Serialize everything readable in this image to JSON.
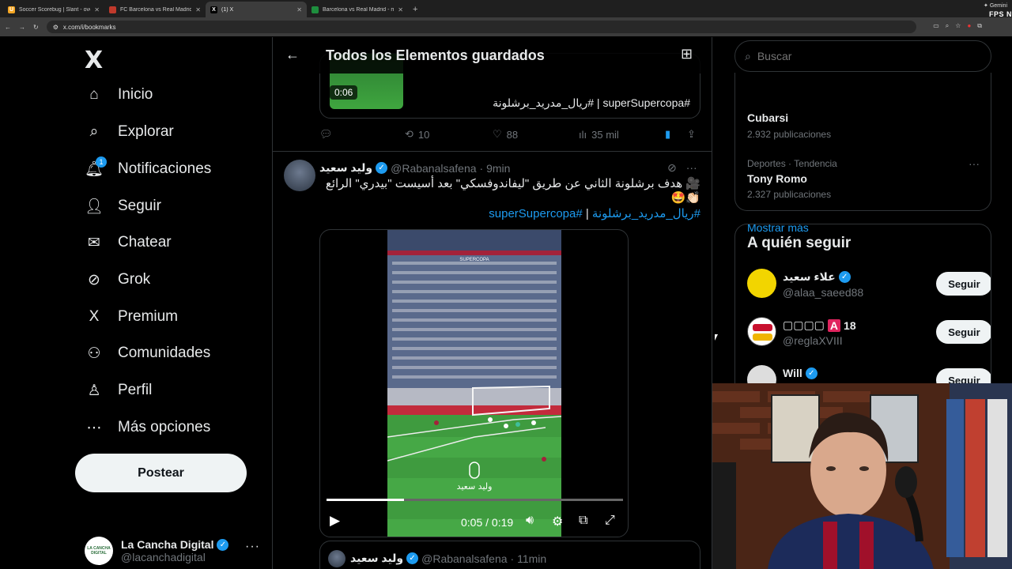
{
  "browser": {
    "tabs": [
      {
        "title": "Soccer Scorebug | Slant - overl",
        "fav_color": "#f5a623",
        "fav_glyph": "U",
        "active": false
      },
      {
        "title": "FC Barcelona vs Real Madrid |",
        "fav_color": "#c0392b",
        "fav_glyph": "",
        "active": false
      },
      {
        "title": "(1) X",
        "fav_color": "#000000",
        "fav_glyph": "X",
        "active": true
      },
      {
        "title": "Barcelona vs Real Madrid - ma",
        "fav_color": "#1e8e3e",
        "fav_glyph": "",
        "active": false
      }
    ],
    "new_tab": "+",
    "gemini": "✦ Gemini",
    "fps": "FPS N",
    "url": "x.com/i/bookmarks"
  },
  "sidebar": {
    "logo": "X",
    "nav": [
      {
        "label": "Inicio",
        "icon": "home-icon",
        "glyph": "⌂"
      },
      {
        "label": "Explorar",
        "icon": "search-icon",
        "glyph": "⌕"
      },
      {
        "label": "Notificaciones",
        "icon": "bell-icon",
        "glyph": "🔔︎",
        "badge": "1"
      },
      {
        "label": "Seguir",
        "icon": "person-add-icon",
        "glyph": "👤︎"
      },
      {
        "label": "Chatear",
        "icon": "mail-icon",
        "glyph": "✉"
      },
      {
        "label": "Grok",
        "icon": "grok-icon",
        "glyph": "⊘"
      },
      {
        "label": "Premium",
        "icon": "x-premium-icon",
        "glyph": "X"
      },
      {
        "label": "Comunidades",
        "icon": "communities-icon",
        "glyph": "⚇"
      },
      {
        "label": "Perfil",
        "icon": "profile-icon",
        "glyph": "♙"
      },
      {
        "label": "Más opciones",
        "icon": "more-circle-icon",
        "glyph": "⋯"
      }
    ],
    "post_label": "Postear",
    "account": {
      "name": "La Cancha Digital",
      "handle": "@lacanchadigital",
      "avatar_text": "LA CANCHA DIGITAL",
      "more": "···"
    }
  },
  "main": {
    "header": {
      "back": "←",
      "title": "Todos los Elementos guardados"
    },
    "tweet1": {
      "duration": "0:06",
      "text": "#superSupercopa | #ريال_مدريد_برشلونة",
      "replies": "",
      "retweets": "10",
      "likes": "88",
      "views": "35 mil"
    },
    "tweet2": {
      "name": "وليد سعيد",
      "handle": "@Rabanalsafena",
      "time": "· 9min",
      "body": "🎥 هدف برشلونة الثاني عن طريق \"ليفاندوفسكي\" بعد أسيست \"بيدري\" الرائع 👏🏻🤩",
      "tag1": "#ريال_مدريد_برشلونة",
      "sep": " | ",
      "tag2": "#superSupercopa",
      "video": {
        "progress": 0.26,
        "time": "0:05 / 0:19",
        "watermark": "وليد سعيد",
        "banner": "SUPERCOPA"
      }
    },
    "tweet3": {
      "name": "وليد سعيد",
      "handle": "@Rabanalsafena",
      "time": "· 11min"
    }
  },
  "right": {
    "search_placeholder": "Buscar",
    "trends": [
      {
        "category": "",
        "name": "Cubarsi",
        "count": "2.932 publicaciones"
      },
      {
        "category": "Deportes · Tendencia",
        "name": "Tony Romo",
        "count": "2.327 publicaciones"
      }
    ],
    "show_more": "Mostrar más",
    "who_to_follow": {
      "title": "A quién seguir",
      "follow_label": "Seguir",
      "users": [
        {
          "name": "علاء سعيد",
          "handle": "@alaa_saeed88",
          "verified": true,
          "avatar_color": "#f2d500"
        },
        {
          "name": "🅰️18",
          "display_boxes": "▢▢▢▢",
          "display_tag": "A",
          "display_num": "18",
          "handle": "@reglaXVIII",
          "verified": false,
          "avatar_color": "#ffffff"
        },
        {
          "name": "Will",
          "handle": "",
          "verified": true,
          "avatar_color": "#dddddd"
        }
      ]
    }
  }
}
